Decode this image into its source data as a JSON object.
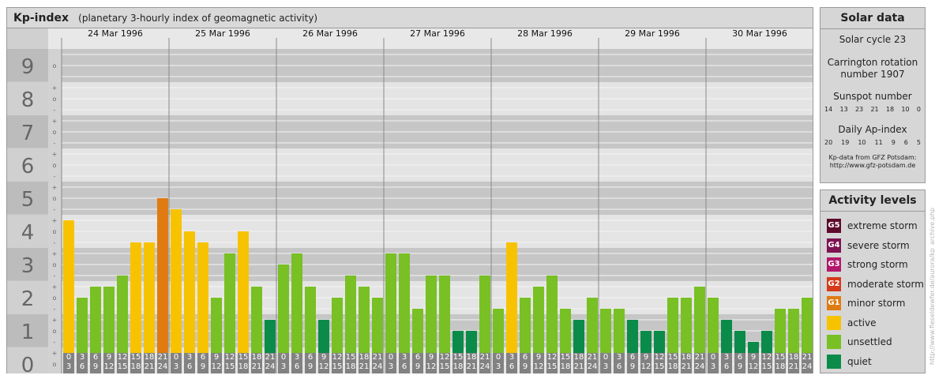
{
  "header": {
    "title": "Kp-index",
    "subtitle": "(planetary 3-hourly index of geomagnetic activity)"
  },
  "chart_data": {
    "type": "bar",
    "title": "Kp-index",
    "subtitle": "(planetary 3-hourly index of geomagnetic activity)",
    "ylim": [
      0,
      9
    ],
    "y_ticks": [
      "0",
      "1",
      "2",
      "3",
      "4",
      "5",
      "6",
      "7",
      "8",
      "9"
    ],
    "y_minor_ticks": [
      "o",
      "+",
      "-"
    ],
    "dates": [
      "24 Mar 1996",
      "25 Mar 1996",
      "26 Mar 1996",
      "27 Mar 1996",
      "28 Mar 1996",
      "29 Mar 1996",
      "30 Mar 1996"
    ],
    "intervals": [
      "0\n3",
      "3\n6",
      "6\n9",
      "9\n12",
      "12\n15",
      "15\n18",
      "18\n21",
      "21\n24"
    ],
    "values": [
      4.333,
      2.0,
      2.333,
      2.333,
      2.667,
      3.667,
      3.667,
      5.0,
      4.667,
      4.0,
      3.667,
      2.0,
      3.333,
      4.0,
      2.333,
      1.333,
      3.0,
      3.333,
      2.333,
      1.333,
      2.0,
      2.667,
      2.333,
      2.0,
      3.333,
      3.333,
      1.667,
      2.667,
      2.667,
      1.0,
      1.0,
      2.667,
      1.667,
      3.667,
      2.0,
      2.333,
      2.667,
      1.667,
      1.333,
      2.0,
      1.667,
      1.667,
      1.333,
      1.0,
      1.0,
      2.0,
      2.0,
      2.333,
      2.0,
      1.333,
      1.0,
      0.667,
      1.0,
      1.667,
      1.667,
      2.0
    ],
    "level_colors": {
      "quiet": "#0b8b49",
      "unsettled": "#78c024",
      "active": "#f7c300",
      "minor": "#e07b12"
    },
    "grid": true
  },
  "solar": {
    "title": "Solar data",
    "cycle": "Solar cycle 23",
    "carrington_line1": "Carrington rotation",
    "carrington_line2": "number 1907",
    "sunspot_title": "Sunspot number",
    "sunspot_values": [
      "14",
      "13",
      "23",
      "21",
      "18",
      "10",
      "0"
    ],
    "ap_title": "Daily Ap-index",
    "ap_values": [
      "20",
      "19",
      "10",
      "11",
      "9",
      "6",
      "5"
    ],
    "source_line1": "Kp-data from GFZ Potsdam:",
    "source_line2": "http://www.gfz-potsdam.de"
  },
  "activity": {
    "title": "Activity levels",
    "items": [
      {
        "code": "G5",
        "label": "extreme storm",
        "color": "#5e0a2a"
      },
      {
        "code": "G4",
        "label": "severe storm",
        "color": "#7e1252"
      },
      {
        "code": "G3",
        "label": "strong storm",
        "color": "#b3176b"
      },
      {
        "code": "G2",
        "label": "moderate storm",
        "color": "#d53a1b"
      },
      {
        "code": "G1",
        "label": "minor storm",
        "color": "#e07b12"
      },
      {
        "code": "",
        "label": "active",
        "color": "#f7c300"
      },
      {
        "code": "",
        "label": "unsettled",
        "color": "#78c024"
      },
      {
        "code": "",
        "label": "quiet",
        "color": "#0b8b49"
      }
    ]
  },
  "watermark": "http://www.fieseldewfer.de/aurora/kp_archive.php"
}
